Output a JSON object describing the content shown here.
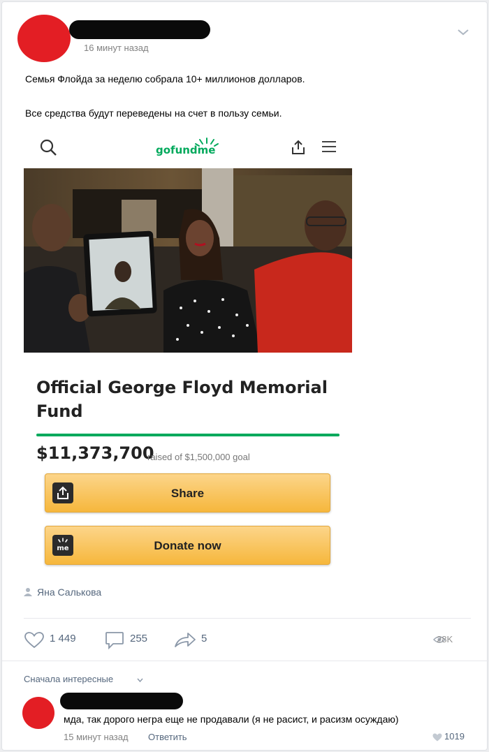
{
  "post": {
    "time": "16 минут назад",
    "text_line1": "Семья Флойда за неделю собрала 10+ миллионов долларов.",
    "text_line2": "Все средства будут переведены на счет в пользу семьи.",
    "author": "Яна Салькова",
    "menu_icon": "chevron-down-icon"
  },
  "embed": {
    "logo_text": "gofundme",
    "fund_title": "Official George Floyd Memorial Fund",
    "amount": "$11,373,700",
    "raised_text": "raised of $1,500,000 goal",
    "progress_fraction": 1.0,
    "share_label": "Share",
    "donate_label": "Donate now",
    "donate_icon_text": "me",
    "accent_color": "#02a95c",
    "button_color": "#f6b73c"
  },
  "actions": {
    "likes": "1 449",
    "comments": "255",
    "reposts": "5",
    "views": "28K"
  },
  "comments": {
    "sort_label": "Сначала интересные",
    "items": [
      {
        "text": "мда, так дорого негра еще не продавали (я не расист, и расизм осуждаю)",
        "time": "15 минут назад",
        "reply_label": "Ответить",
        "likes": "1019"
      }
    ]
  }
}
